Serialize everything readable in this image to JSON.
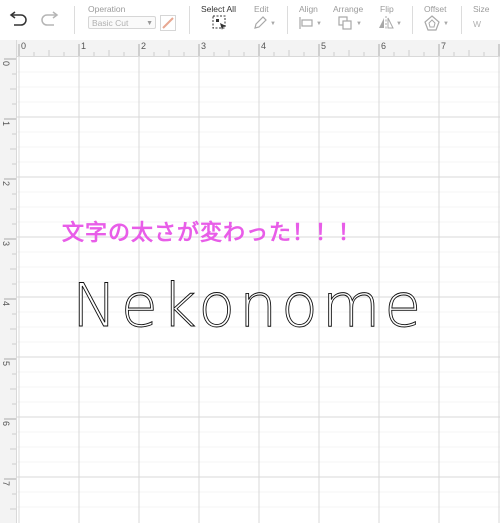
{
  "toolbar": {
    "operation": {
      "label": "Operation",
      "value": "Basic Cut"
    },
    "select_all": {
      "label": "Select All"
    },
    "edit": {
      "label": "Edit"
    },
    "align": {
      "label": "Align"
    },
    "arrange": {
      "label": "Arrange"
    },
    "flip": {
      "label": "Flip"
    },
    "offset": {
      "label": "Offset"
    },
    "size": {
      "label": "Size",
      "w_label": "W"
    }
  },
  "ruler": {
    "top": [
      "0",
      "1",
      "2",
      "3",
      "4",
      "5",
      "6",
      "7"
    ],
    "left": [
      "0",
      "1",
      "2",
      "3",
      "4",
      "5",
      "6",
      "7"
    ]
  },
  "canvas": {
    "annotation": "文字の太さが変わった！！！",
    "design_text": "Nekonome"
  },
  "colors": {
    "annotation": "#e85de8",
    "grid": "#d8d8d8",
    "ruler_bg": "#f3f3f3",
    "line_type_swatch": "#e8a892"
  }
}
